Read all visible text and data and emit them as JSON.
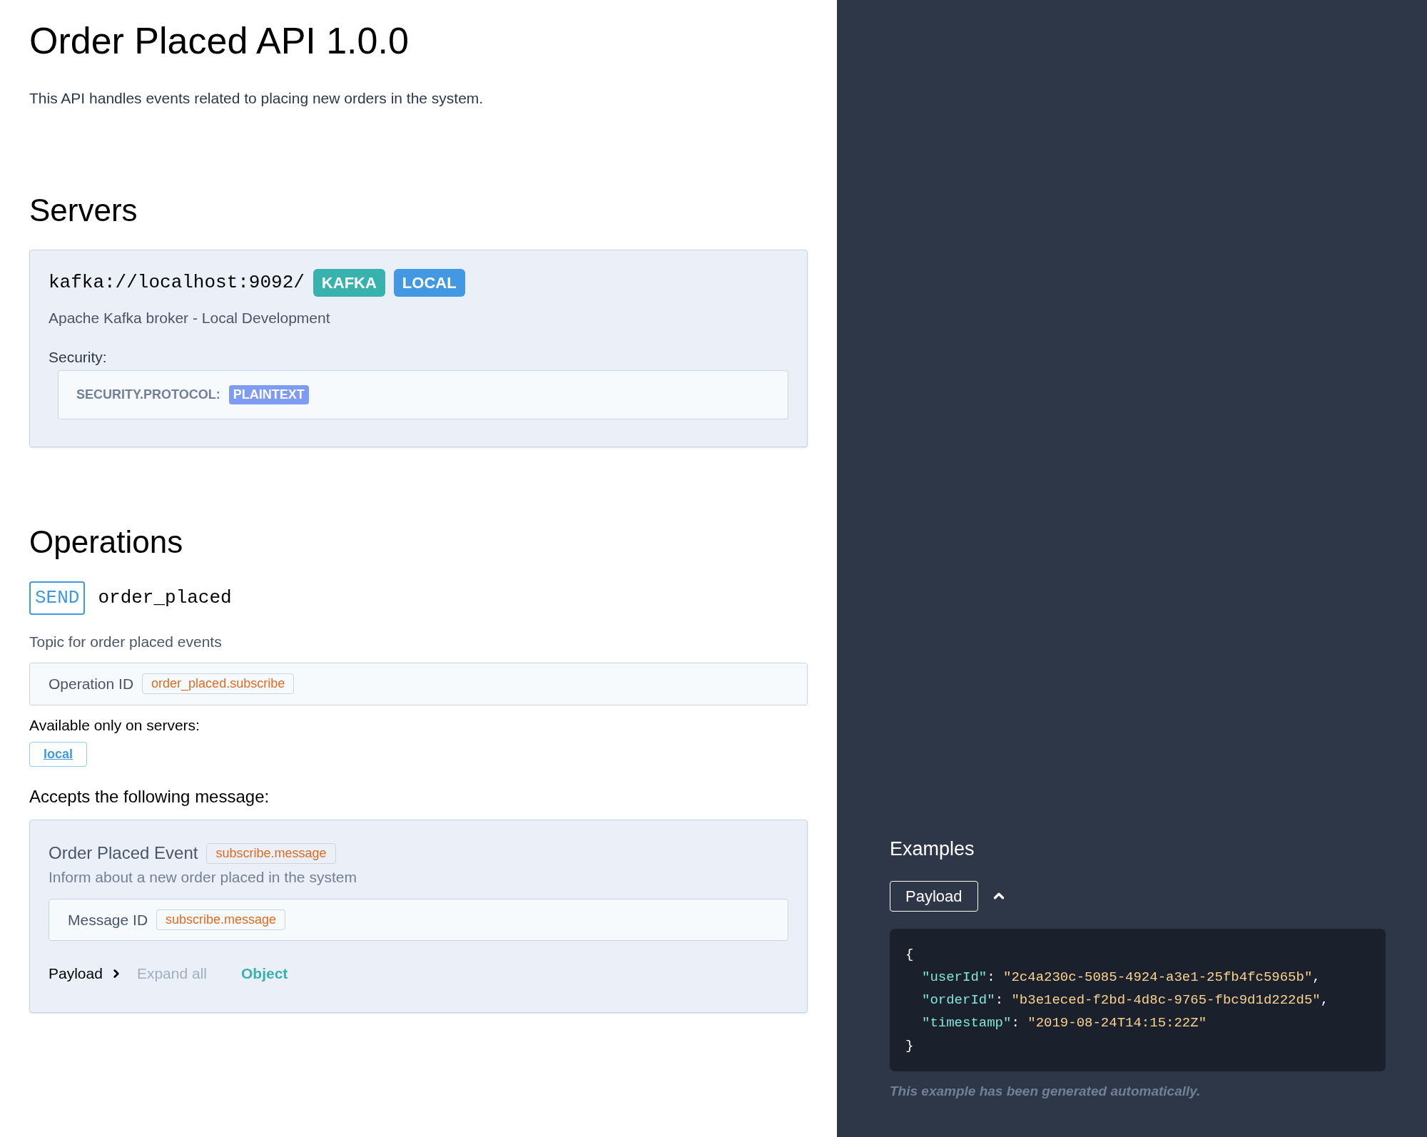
{
  "title": "Order Placed API 1.0.0",
  "description": "This API handles events related to placing new orders in the system.",
  "servers": {
    "heading": "Servers",
    "items": [
      {
        "url": "kafka://localhost:9092/",
        "badges": [
          {
            "text": "KAFKA",
            "color": "#38b2ac"
          },
          {
            "text": "LOCAL",
            "color": "#4299e1"
          }
        ],
        "description": "Apache Kafka broker - Local Development",
        "security_label": "Security:",
        "security": [
          {
            "key": "SECURITY.PROTOCOL:",
            "value": "PLAINTEXT"
          }
        ]
      }
    ]
  },
  "operations": {
    "heading": "Operations",
    "items": [
      {
        "action": "SEND",
        "channel": "order_placed",
        "description": "Topic for order placed events",
        "id_label": "Operation ID",
        "id": "order_placed.subscribe",
        "servers_label": "Available only on servers:",
        "servers": [
          "local"
        ],
        "message_label": "Accepts the following message:",
        "message": {
          "title": "Order Placed Event",
          "tag": "subscribe.message",
          "summary": "Inform about a new order placed in the system",
          "id_label": "Message ID",
          "id": "subscribe.message",
          "payload_label": "Payload",
          "expanded": false,
          "expand_all": "Expand all",
          "type": "Object"
        }
      }
    ]
  },
  "examples": {
    "heading": "Examples",
    "tab": "Payload",
    "expanded": true,
    "open": "{",
    "close": "}",
    "fields": [
      {
        "key": "\"userId\"",
        "colon": ":",
        "value": "\"2c4a230c-5085-4924-a3e1-25fb4fc5965b\"",
        "sep": ","
      },
      {
        "key": "\"orderId\"",
        "colon": ":",
        "value": "\"b3e1eced-f2bd-4d8c-9765-fbc9d1d222d5\"",
        "sep": ","
      },
      {
        "key": "\"timestamp\"",
        "colon": ":",
        "value": "\"2019-08-24T14:15:22Z\""
      }
    ],
    "note": "This example has been generated automatically."
  }
}
